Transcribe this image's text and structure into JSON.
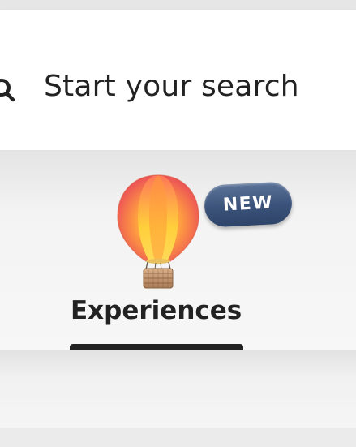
{
  "search": {
    "label": "Start your search",
    "icon": "search-icon"
  },
  "tabs": [
    {
      "label": "Experiences",
      "icon": "hot-air-balloon-icon",
      "badge": "NEW",
      "active": true
    }
  ],
  "colors": {
    "text": "#222222",
    "badge": "#3b527a",
    "active_indicator": "#222222"
  }
}
